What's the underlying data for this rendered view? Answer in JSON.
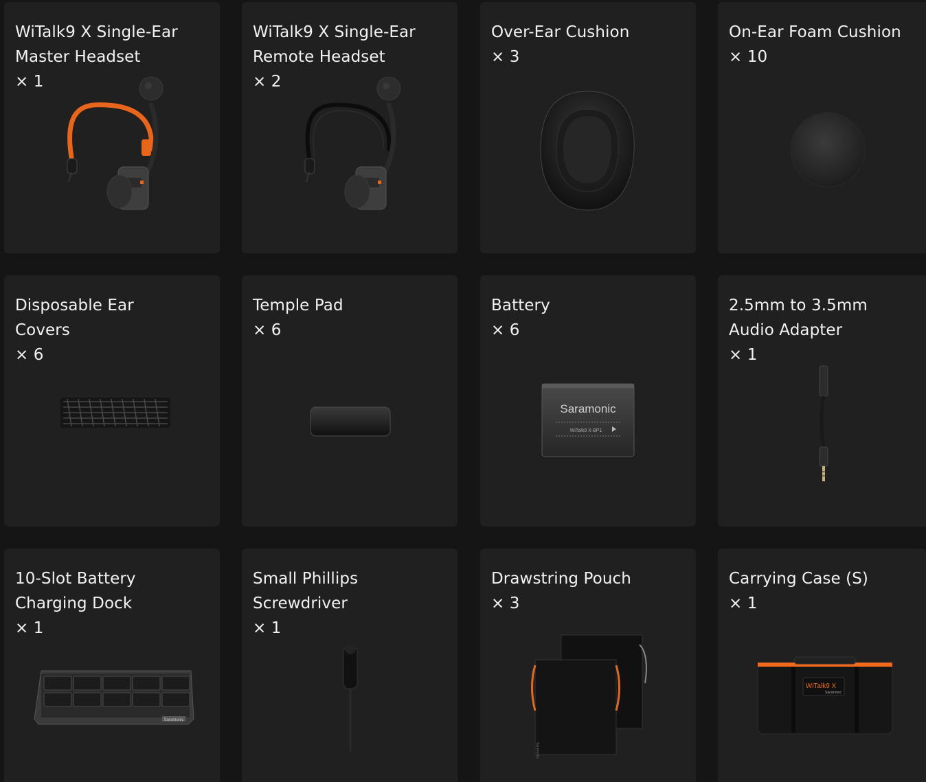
{
  "items": [
    {
      "title": [
        "WiTalk9 X Single-Ear",
        "Master Headset"
      ],
      "qty": "× 1",
      "image": "master-headset-image"
    },
    {
      "title": [
        "WiTalk9 X Single-Ear",
        "Remote Headset"
      ],
      "qty": "× 2",
      "image": "remote-headset-image"
    },
    {
      "title": [
        "Over-Ear Cushion"
      ],
      "qty": "× 3",
      "image": "over-ear-cushion-image"
    },
    {
      "title": [
        "On-Ear Foam Cushion"
      ],
      "qty": "× 10",
      "image": "foam-cushion-image"
    },
    {
      "title": [
        "Disposable Ear",
        "Covers"
      ],
      "qty": "× 6",
      "image": "ear-covers-image"
    },
    {
      "title": [
        "Temple Pad"
      ],
      "qty": "× 6",
      "image": "temple-pad-image"
    },
    {
      "title": [
        "Battery"
      ],
      "qty": "× 6",
      "image": "battery-image",
      "brand": "Saramonic",
      "model": "WiTalk9 X-BP1"
    },
    {
      "title": [
        "2.5mm to 3.5mm",
        "Audio Adapter"
      ],
      "qty": "× 1",
      "image": "audio-adapter-image"
    },
    {
      "title": [
        "10-Slot Battery",
        "Charging Dock"
      ],
      "qty": "× 1",
      "image": "charging-dock-image",
      "brand": "Saramonic"
    },
    {
      "title": [
        "Small Phillips",
        "Screwdriver"
      ],
      "qty": "× 1",
      "image": "screwdriver-image"
    },
    {
      "title": [
        "Drawstring Pouch"
      ],
      "qty": "× 3",
      "image": "drawstring-pouch-image",
      "brand": "Saramonic"
    },
    {
      "title": [
        "Carrying Case (S)"
      ],
      "qty": "× 1",
      "image": "carrying-case-image",
      "brand": "Saramonic",
      "logo": "WiTalk9 X"
    }
  ],
  "colors": {
    "page_bg": "#151515",
    "card_bg": "#202020",
    "text": "#f2f2f2",
    "accent_orange": "#f06a1a"
  }
}
